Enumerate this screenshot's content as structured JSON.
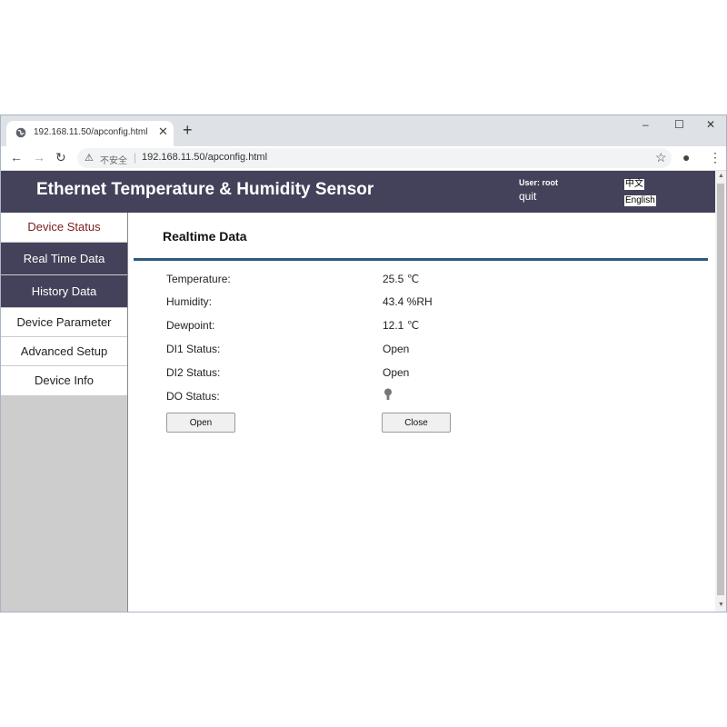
{
  "browser": {
    "tab_title": "192.168.11.50/apconfig.html",
    "tab_close": "✕",
    "new_tab": "+",
    "window_controls": {
      "minimize": "–",
      "maximize": "☐",
      "close": "✕"
    },
    "nav": {
      "back": "←",
      "forward": "→",
      "reload": "↻"
    },
    "insecure_label": "不安全",
    "separator": "|",
    "url": "192.168.11.50/apconfig.html",
    "icons": {
      "bookmark": "☆",
      "account": "●",
      "menu": "⋮"
    }
  },
  "header": {
    "title": "Ethernet Temperature & Humidity Sensor",
    "user": "User: root",
    "quit": "quit",
    "lang_zh": "中文",
    "lang_en": "English"
  },
  "sidebar": {
    "items": [
      {
        "label": "Device Status",
        "style": "white",
        "color": "#7a1c1c"
      },
      {
        "label": "Real Time Data",
        "style": "dark"
      },
      {
        "label": "History Data",
        "style": "dark"
      },
      {
        "label": "Device Parameter",
        "style": "white"
      },
      {
        "label": "Advanced Setup",
        "style": "white"
      },
      {
        "label": "Device Info",
        "style": "white"
      }
    ]
  },
  "main": {
    "section_title": "Realtime Data",
    "rows": [
      {
        "label": "Temperature:",
        "value": "25.5 ℃"
      },
      {
        "label": "Humidity:",
        "value": "43.4 %RH"
      },
      {
        "label": "Dewpoint:",
        "value": "12.1 ℃"
      },
      {
        "label": "DI1 Status:",
        "value": "Open"
      },
      {
        "label": "DI2 Status:",
        "value": "Open"
      },
      {
        "label": "DO Status:",
        "value": ""
      }
    ],
    "do_status_icon": "bulb-icon",
    "open_button": "Open",
    "close_button": "Close"
  },
  "colors": {
    "header_bg": "#43425a",
    "rule": "#2c5a7f",
    "sidebar_bg": "#cdcdcd",
    "active_item_text": "#7a1c1c"
  }
}
